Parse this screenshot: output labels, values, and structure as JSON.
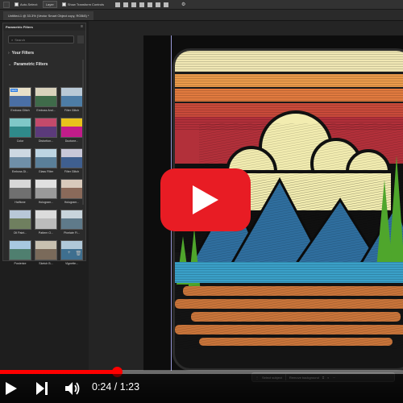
{
  "options_bar": {
    "auto_select_label": "Auto-Select:",
    "auto_select_value": "Layer",
    "transform_label": "Show Transform Controls"
  },
  "document_tab": {
    "title": "Untitled-1 @ 33.3% (Vector Smart Object copy, RGB/8) *"
  },
  "filters_panel": {
    "title": "Parametric Filters",
    "search_placeholder": "Search",
    "section_your_filters": "Your Filters",
    "section_parametric": "Parametric Filters",
    "new_badge": "NEW",
    "tiles": [
      {
        "label": "Emboss Glitch",
        "sky": "#e8e0c8",
        "ground": "#4a6fa5"
      },
      {
        "label": "Emboss And...",
        "sky": "#d8d2bc",
        "ground": "#3f6b4a"
      },
      {
        "label": "Filter Glitch",
        "sky": "#b9c9d6",
        "ground": "#4d7da6"
      },
      {
        "label": "Color",
        "sky": "#7fc8c8",
        "ground": "#2f8a8a"
      },
      {
        "label": "Distortion...",
        "sky": "#c44a6b",
        "ground": "#5b3a7a"
      },
      {
        "label": "Duotone...",
        "sky": "#e8c21c",
        "ground": "#c21c8a"
      },
      {
        "label": "Emboss Di...",
        "sky": "#cdd8e2",
        "ground": "#6f8fa8"
      },
      {
        "label": "Glass Filter",
        "sky": "#bcd4e2",
        "ground": "#5a7f99"
      },
      {
        "label": "Filter Glitch",
        "sky": "#c8c8d8",
        "ground": "#3f5f8f"
      },
      {
        "label": "Halftone",
        "sky": "#d8d8d8",
        "ground": "#707070"
      },
      {
        "label": "Hologram...",
        "sky": "#e0e0e0",
        "ground": "#9a9a9a"
      },
      {
        "label": "Hologram...",
        "sky": "#d8cabc",
        "ground": "#8a6a5a"
      },
      {
        "label": "Oil Paint...",
        "sky": "#b8c8d8",
        "ground": "#6f7f5f"
      },
      {
        "label": "Pattern O...",
        "sky": "#dcdcdc",
        "ground": "#bcbcbc"
      },
      {
        "label": "Pixelate Fi...",
        "sky": "#c8d4dc",
        "ground": "#5f7a8a"
      },
      {
        "label": "Posterize",
        "sky": "#a8c8e0",
        "ground": "#4f7f6f"
      },
      {
        "label": "Sketch B...",
        "sky": "#c8c0b0",
        "ground": "#7a6a5a"
      },
      {
        "label": "Vignette...",
        "sky": "#b0c8d8",
        "ground": "#3f6f8f"
      }
    ]
  },
  "context_bar": {
    "select_subject": "Select subject",
    "remove_background": "Remove background"
  },
  "video": {
    "current_time": "0:24",
    "duration": "1:23",
    "time_display": "0:24 / 1:23",
    "progress_fraction": 0.29,
    "play_button_color": "#e81c24",
    "progress_color": "#ff0000"
  },
  "artwork": {
    "stripe_colors": [
      "#f0e7b4",
      "#ea9a4a",
      "#e17a3e",
      "#c94a3a",
      "#b2303a"
    ],
    "sun_color": "#f2ecb0",
    "mountain_color": "#2f6e9e",
    "lake_color": "#3aa0c8",
    "shore_color": "#c8743a",
    "tree_color": "#4fa62c"
  }
}
